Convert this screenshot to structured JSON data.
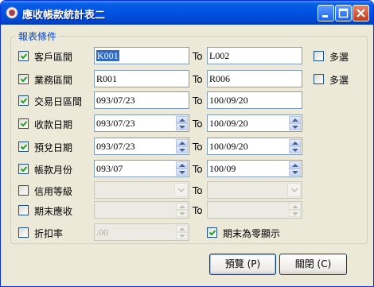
{
  "window": {
    "title": "應收帳款統計表二",
    "app_icon": "app-icon",
    "controls": [
      "minimize-icon",
      "maximize-icon",
      "close-icon"
    ]
  },
  "group": {
    "title": "報表條件"
  },
  "to_label": "To",
  "rows": [
    {
      "label": "客戶區間",
      "checked": true,
      "from": "K001",
      "to": "L002",
      "multi_label": "多選",
      "multi_checked": false
    },
    {
      "label": "業務區間",
      "checked": true,
      "from": "R001",
      "to": "R006",
      "multi_label": "多選",
      "multi_checked": false
    },
    {
      "label": "交易日區間",
      "checked": true,
      "from": "093/07/23",
      "to": "100/09/20"
    },
    {
      "label": "收款日期",
      "checked": true,
      "from": "093/07/23",
      "to": "100/09/20"
    },
    {
      "label": "預兌日期",
      "checked": true,
      "from": "093/07/23",
      "to": "100/09/20"
    },
    {
      "label": "帳款月份",
      "checked": true,
      "from": "093/07",
      "to": "100/09"
    },
    {
      "label": "信用等級",
      "checked": false,
      "from": "",
      "to": ""
    },
    {
      "label": "期末應收",
      "checked": false,
      "from": "",
      "to": ""
    },
    {
      "label": "折扣率",
      "checked": false,
      "value": ".00",
      "zero_label": "期末為零顯示",
      "zero_checked": true
    }
  ],
  "buttons": {
    "preview": "預覽 (P)",
    "close": "關閉 (C)"
  },
  "colors": {
    "title_bar": "#0054e3",
    "group_title": "#0046d5",
    "selection": "#316ac5",
    "check": "#21a121"
  }
}
